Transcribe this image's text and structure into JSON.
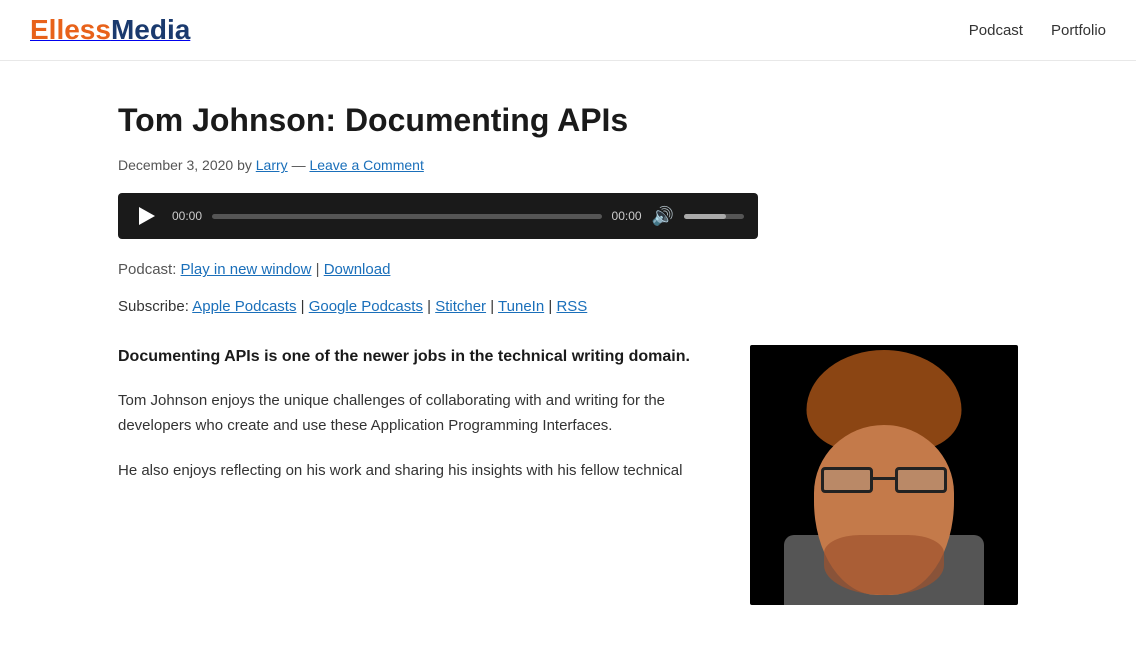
{
  "header": {
    "logo_eless": "Elless",
    "logo_media": "Media",
    "nav": [
      {
        "label": "Podcast",
        "href": "#"
      },
      {
        "label": "Portfolio",
        "href": "#"
      }
    ]
  },
  "article": {
    "title": "Tom Johnson: Documenting APIs",
    "meta": {
      "date": "December 3, 2020",
      "by": "by",
      "author": "Larry",
      "separator": "—",
      "comment_link": "Leave a Comment"
    },
    "audio": {
      "time_start": "00:00",
      "time_end": "00:00"
    },
    "podcast_label": "Podcast:",
    "play_new_window": "Play in new window",
    "separator1": "|",
    "download": "Download",
    "subscribe_label": "Subscribe:",
    "subscribe_links": [
      {
        "label": "Apple Podcasts",
        "separator": "|"
      },
      {
        "label": "Google Podcasts",
        "separator": "|"
      },
      {
        "label": "Stitcher",
        "separator": "|"
      },
      {
        "label": "TuneIn",
        "separator": "|"
      },
      {
        "label": "RSS",
        "separator": ""
      }
    ],
    "lead_paragraph": "Documenting APIs is one of the newer jobs in the technical writing domain.",
    "body_paragraphs": [
      "Tom Johnson enjoys the unique challenges of collaborating with and writing for the developers who create and use these Application Programming Interfaces.",
      "He also enjoys reflecting on his work and sharing his insights with his fellow technical"
    ]
  }
}
